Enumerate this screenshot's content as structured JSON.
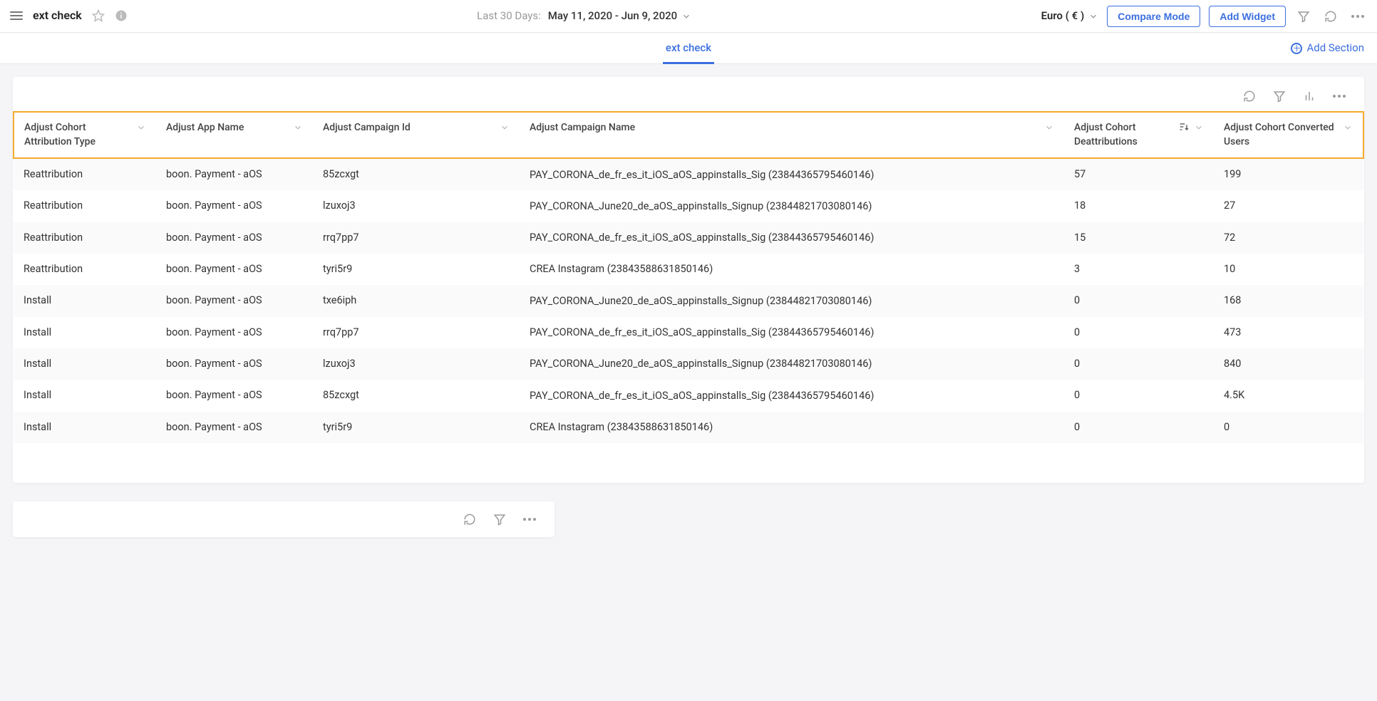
{
  "header": {
    "title": "ext check",
    "date_label": "Last 30 Days:",
    "date_value": "May 11, 2020 - Jun 9, 2020",
    "currency_label": "Euro ( € )",
    "compare_btn": "Compare Mode",
    "add_widget_btn": "Add Widget"
  },
  "subbar": {
    "tab": "ext check",
    "add_section": "Add Section"
  },
  "table": {
    "columns": [
      "Adjust Cohort Attribution Type",
      "Adjust App Name",
      "Adjust Campaign Id",
      "Adjust Campaign Name",
      "Adjust Cohort Deattributions",
      "Adjust Cohort Converted Users"
    ],
    "sorted_col_index": 4,
    "rows": [
      {
        "c0": "Reattribution",
        "c1": "boon. Payment - aOS",
        "c2": "85zcxgt",
        "c3": "PAY_CORONA_de_fr_es_it_iOS_aOS_appinstalls_Sig (23844365795460146)",
        "c4": "57",
        "c5": "199"
      },
      {
        "c0": "Reattribution",
        "c1": "boon. Payment - aOS",
        "c2": "lzuxoj3",
        "c3": "PAY_CORONA_June20_de_aOS_appinstalls_Signup (23844821703080146)",
        "c4": "18",
        "c5": "27"
      },
      {
        "c0": "Reattribution",
        "c1": "boon. Payment - aOS",
        "c2": "rrq7pp7",
        "c3": "PAY_CORONA_de_fr_es_it_iOS_aOS_appinstalls_Sig (23844365795460146)",
        "c4": "15",
        "c5": "72"
      },
      {
        "c0": "Reattribution",
        "c1": "boon. Payment - aOS",
        "c2": "tyri5r9",
        "c3": "CREA Instagram (23843588631850146)",
        "c4": "3",
        "c5": "10"
      },
      {
        "c0": "Install",
        "c1": "boon. Payment - aOS",
        "c2": "txe6iph",
        "c3": "PAY_CORONA_June20_de_aOS_appinstalls_Signup (23844821703080146)",
        "c4": "0",
        "c5": "168"
      },
      {
        "c0": "Install",
        "c1": "boon. Payment - aOS",
        "c2": "rrq7pp7",
        "c3": "PAY_CORONA_de_fr_es_it_iOS_aOS_appinstalls_Sig (23844365795460146)",
        "c4": "0",
        "c5": "473"
      },
      {
        "c0": "Install",
        "c1": "boon. Payment - aOS",
        "c2": "lzuxoj3",
        "c3": "PAY_CORONA_June20_de_aOS_appinstalls_Signup (23844821703080146)",
        "c4": "0",
        "c5": "840"
      },
      {
        "c0": "Install",
        "c1": "boon. Payment - aOS",
        "c2": "85zcxgt",
        "c3": "PAY_CORONA_de_fr_es_it_iOS_aOS_appinstalls_Sig (23844365795460146)",
        "c4": "0",
        "c5": "4.5K"
      },
      {
        "c0": "Install",
        "c1": "boon. Payment - aOS",
        "c2": "tyri5r9",
        "c3": "CREA Instagram (23843588631850146)",
        "c4": "0",
        "c5": "0"
      }
    ]
  }
}
